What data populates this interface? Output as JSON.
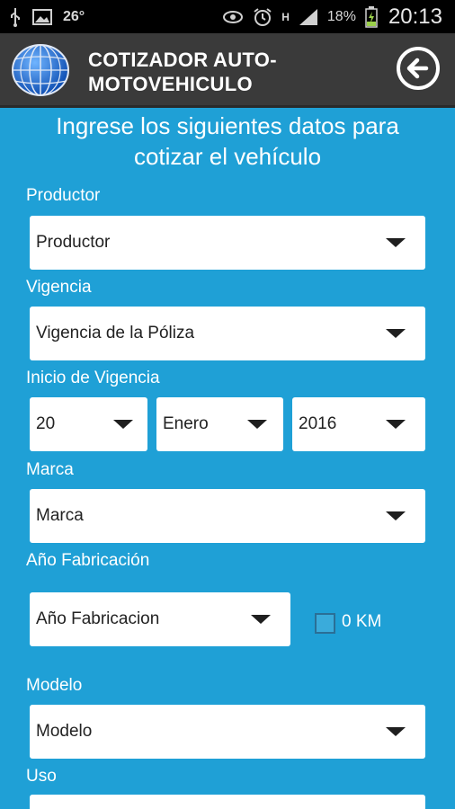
{
  "status_bar": {
    "temperature": "26°",
    "battery": "18%",
    "time": "20:13",
    "network": "H"
  },
  "app_bar": {
    "title_line1": "COTIZADOR AUTO-",
    "title_line2": "MOTOVEHICULO",
    "logo_icon": "globe-icon",
    "back_icon": "back-arrow-icon"
  },
  "heading": {
    "line1": "Ingrese los siguientes datos para",
    "line2": "cotizar el vehículo"
  },
  "form": {
    "productor": {
      "label": "Productor",
      "value": "Productor"
    },
    "vigencia": {
      "label": "Vigencia",
      "value": "Vigencia de la Póliza"
    },
    "inicio_vigencia": {
      "label": "Inicio de Vigencia",
      "day": "20",
      "month": "Enero",
      "year": "2016"
    },
    "marca": {
      "label": "Marca",
      "value": "Marca"
    },
    "anio_fabricacion": {
      "label": "Año Fabricación",
      "value": "Año Fabricacion",
      "zero_km_label": "0 KM",
      "zero_km_checked": false
    },
    "modelo": {
      "label": "Modelo",
      "value": "Modelo"
    },
    "uso": {
      "label": "Uso",
      "value": ""
    }
  },
  "colors": {
    "background": "#1fa0d6",
    "app_bar": "#3a3a3a",
    "status_bar": "#000000"
  }
}
